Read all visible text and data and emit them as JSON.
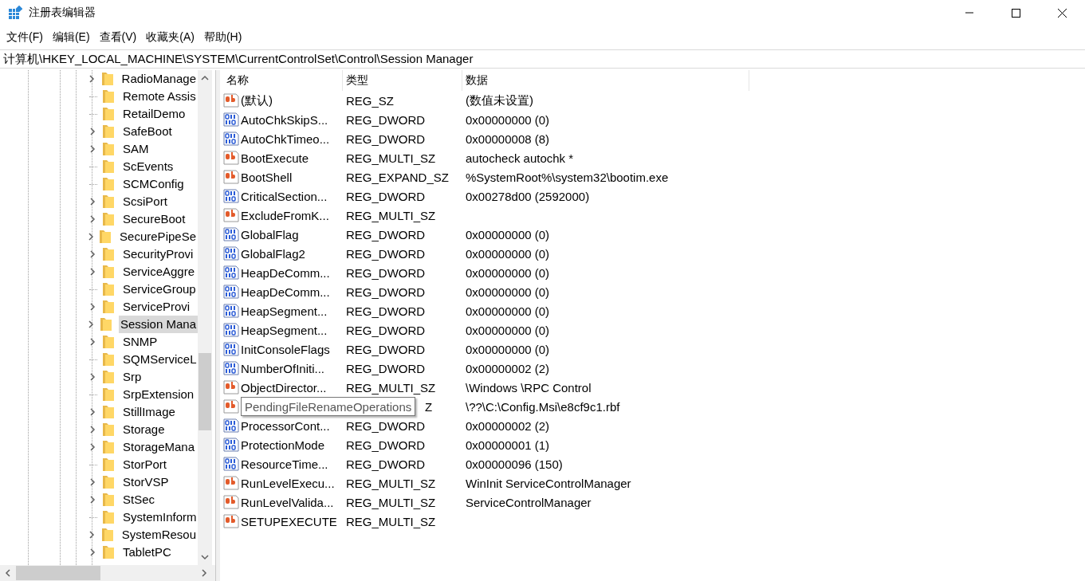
{
  "window": {
    "title": "注册表编辑器"
  },
  "menu": [
    "文件(F)",
    "编辑(E)",
    "查看(V)",
    "收藏夹(A)",
    "帮助(H)"
  ],
  "address": "计算机\\HKEY_LOCAL_MACHINE\\SYSTEM\\CurrentControlSet\\Control\\Session Manager",
  "tree": [
    {
      "label": "RadioManage",
      "expandable": true,
      "selected": false
    },
    {
      "label": "Remote Assis",
      "expandable": false,
      "selected": false
    },
    {
      "label": "RetailDemo",
      "expandable": false,
      "selected": false
    },
    {
      "label": "SafeBoot",
      "expandable": true,
      "selected": false
    },
    {
      "label": "SAM",
      "expandable": true,
      "selected": false
    },
    {
      "label": "ScEvents",
      "expandable": false,
      "selected": false
    },
    {
      "label": "SCMConfig",
      "expandable": false,
      "selected": false
    },
    {
      "label": "ScsiPort",
      "expandable": true,
      "selected": false
    },
    {
      "label": "SecureBoot",
      "expandable": true,
      "selected": false
    },
    {
      "label": "SecurePipeSe",
      "expandable": true,
      "selected": false
    },
    {
      "label": "SecurityProvi",
      "expandable": true,
      "selected": false
    },
    {
      "label": "ServiceAggre",
      "expandable": true,
      "selected": false
    },
    {
      "label": "ServiceGroup",
      "expandable": false,
      "selected": false
    },
    {
      "label": "ServiceProvi",
      "expandable": true,
      "selected": false
    },
    {
      "label": "Session Mana",
      "expandable": true,
      "selected": true
    },
    {
      "label": "SNMP",
      "expandable": true,
      "selected": false
    },
    {
      "label": "SQMServiceL",
      "expandable": false,
      "selected": false
    },
    {
      "label": "Srp",
      "expandable": true,
      "selected": false
    },
    {
      "label": "SrpExtension",
      "expandable": false,
      "selected": false
    },
    {
      "label": "StillImage",
      "expandable": true,
      "selected": false
    },
    {
      "label": "Storage",
      "expandable": true,
      "selected": false
    },
    {
      "label": "StorageMana",
      "expandable": true,
      "selected": false
    },
    {
      "label": "StorPort",
      "expandable": false,
      "selected": false
    },
    {
      "label": "StorVSP",
      "expandable": true,
      "selected": false
    },
    {
      "label": "StSec",
      "expandable": true,
      "selected": false
    },
    {
      "label": "SystemInform",
      "expandable": false,
      "selected": false
    },
    {
      "label": "SystemResou",
      "expandable": true,
      "selected": false
    },
    {
      "label": "TabletPC",
      "expandable": true,
      "selected": false
    }
  ],
  "table": {
    "columns": [
      "名称",
      "类型",
      "数据"
    ],
    "rows": [
      {
        "kind": "sz",
        "name": "(默认)",
        "type": "REG_SZ",
        "data": "(数值未设置)"
      },
      {
        "kind": "dword",
        "name": "AutoChkSkipS...",
        "type": "REG_DWORD",
        "data": "0x00000000 (0)"
      },
      {
        "kind": "dword",
        "name": "AutoChkTimeo...",
        "type": "REG_DWORD",
        "data": "0x00000008 (8)"
      },
      {
        "kind": "sz",
        "name": "BootExecute",
        "type": "REG_MULTI_SZ",
        "data": "autocheck autochk *"
      },
      {
        "kind": "sz",
        "name": "BootShell",
        "type": "REG_EXPAND_SZ",
        "data": "%SystemRoot%\\system32\\bootim.exe"
      },
      {
        "kind": "dword",
        "name": "CriticalSection...",
        "type": "REG_DWORD",
        "data": "0x00278d00 (2592000)"
      },
      {
        "kind": "sz",
        "name": "ExcludeFromK...",
        "type": "REG_MULTI_SZ"
      },
      {
        "kind": "dword",
        "name": "GlobalFlag",
        "type": "REG_DWORD",
        "data": "0x00000000 (0)"
      },
      {
        "kind": "dword",
        "name": "GlobalFlag2",
        "type": "REG_DWORD",
        "data": "0x00000000 (0)"
      },
      {
        "kind": "dword",
        "name": "HeapDeComm...",
        "type": "REG_DWORD",
        "data": "0x00000000 (0)"
      },
      {
        "kind": "dword",
        "name": "HeapDeComm...",
        "type": "REG_DWORD",
        "data": "0x00000000 (0)"
      },
      {
        "kind": "dword",
        "name": "HeapSegment...",
        "type": "REG_DWORD",
        "data": "0x00000000 (0)"
      },
      {
        "kind": "dword",
        "name": "HeapSegment...",
        "type": "REG_DWORD",
        "data": "0x00000000 (0)"
      },
      {
        "kind": "dword",
        "name": "InitConsoleFlags",
        "type": "REG_DWORD",
        "data": "0x00000000 (0)"
      },
      {
        "kind": "dword",
        "name": "NumberOfIniti...",
        "type": "REG_DWORD",
        "data": "0x00000002 (2)"
      },
      {
        "kind": "sz",
        "name": "ObjectDirector...",
        "type": "REG_MULTI_SZ",
        "data": "\\Windows \\RPC Control"
      },
      {
        "kind": "sz",
        "type": "Z",
        "data": "\\??\\C:\\Config.Msi\\e8cf9c1.rbf",
        "tooltip": "PendingFileRenameOperations"
      },
      {
        "kind": "dword",
        "name": "ProcessorCont...",
        "type": "REG_DWORD",
        "data": "0x00000002 (2)"
      },
      {
        "kind": "dword",
        "name": "ProtectionMode",
        "type": "REG_DWORD",
        "data": "0x00000001 (1)"
      },
      {
        "kind": "dword",
        "name": "ResourceTime...",
        "type": "REG_DWORD",
        "data": "0x00000096 (150)"
      },
      {
        "kind": "sz",
        "name": "RunLevelExecu...",
        "type": "REG_MULTI_SZ",
        "data": "WinInit ServiceControlManager"
      },
      {
        "kind": "sz",
        "name": "RunLevelValida...",
        "type": "REG_MULTI_SZ",
        "data": "ServiceControlManager"
      },
      {
        "kind": "sz",
        "name": "SETUPEXECUTE",
        "type": "REG_MULTI_SZ"
      }
    ]
  }
}
